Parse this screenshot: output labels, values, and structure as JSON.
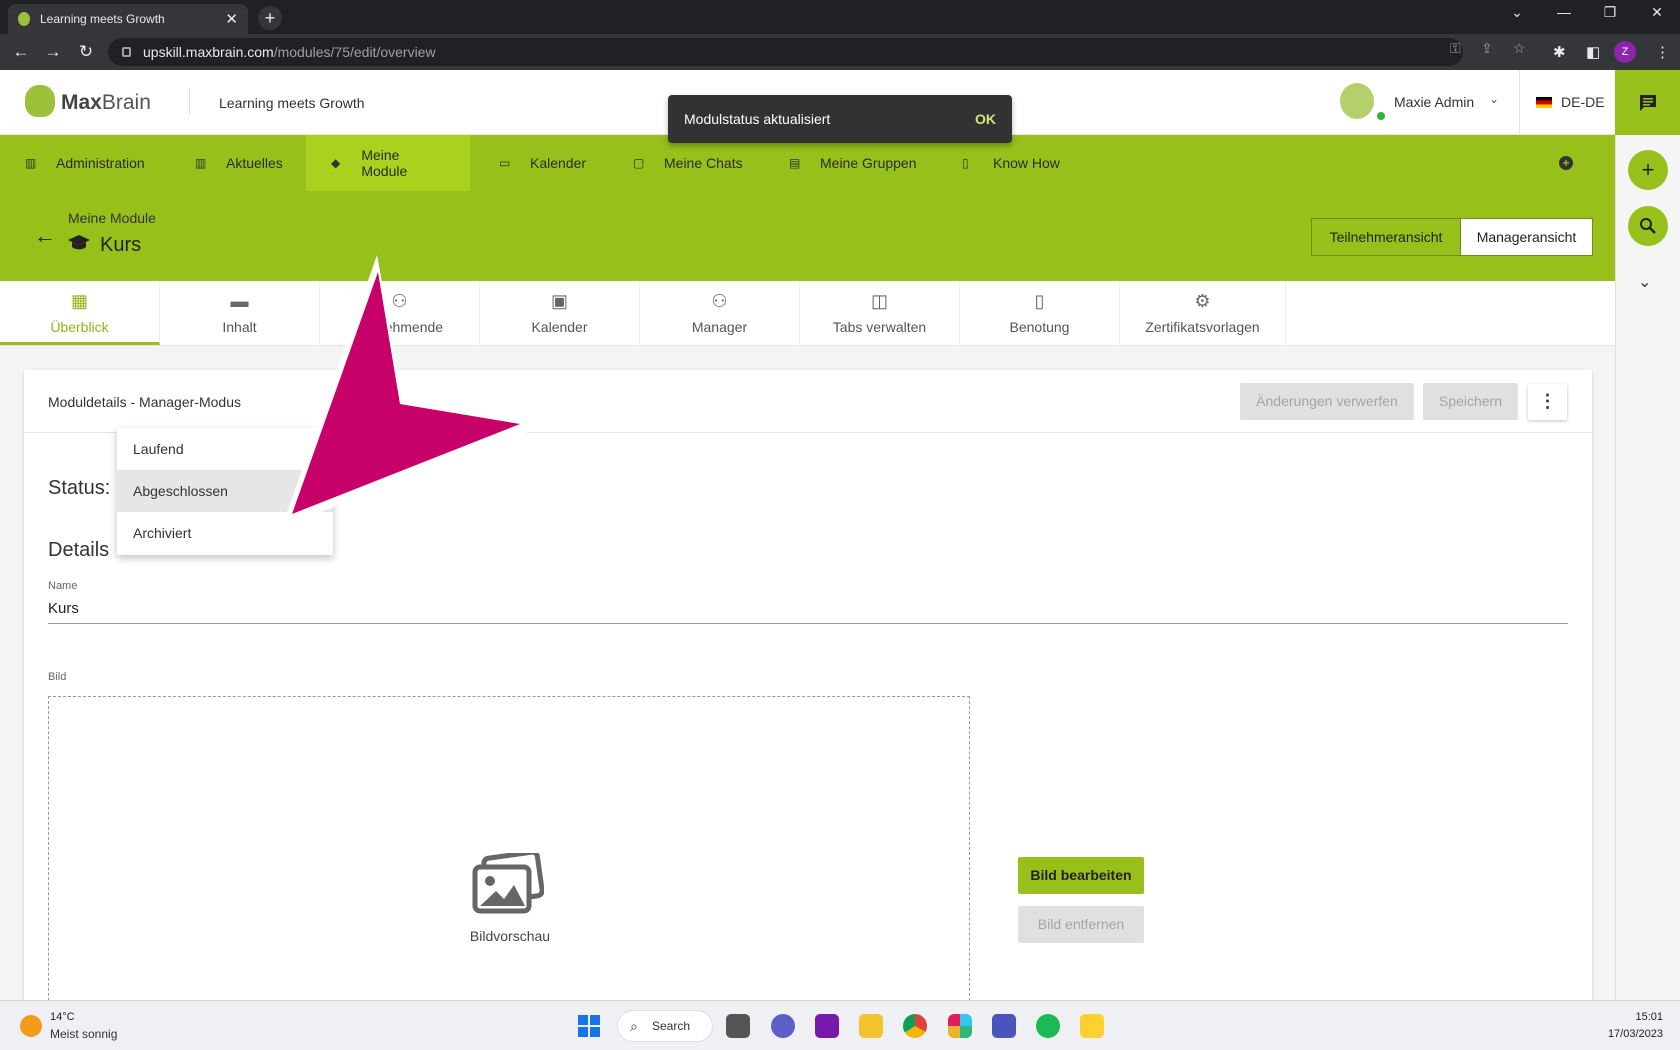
{
  "browser": {
    "tab_title": "Learning meets Growth",
    "url_host": "upskill.maxbrain.com",
    "url_path": "/modules/75/edit/overview",
    "profile_initial": "Z"
  },
  "header": {
    "brand_bold": "Max",
    "brand_light": "Brain",
    "tagline": "Learning meets Growth",
    "user_name": "Maxie Admin",
    "language": "DE-DE"
  },
  "toast": {
    "message": "Modulstatus aktualisiert",
    "action": "OK"
  },
  "main_nav": {
    "items": [
      {
        "label": "Administration",
        "icon": "building-icon"
      },
      {
        "label": "Aktuelles",
        "icon": "news-icon"
      },
      {
        "label": "Meine Module",
        "icon": "graduation-cap-icon"
      },
      {
        "label": "Kalender",
        "icon": "calendar-icon"
      },
      {
        "label": "Meine Chats",
        "icon": "chat-icon"
      },
      {
        "label": "Meine Gruppen",
        "icon": "group-icon"
      },
      {
        "label": "Know How",
        "icon": "book-icon"
      }
    ],
    "active": "Meine Module"
  },
  "page": {
    "breadcrumb": "Meine Module",
    "title": "Kurs",
    "view_participant": "Teilnehmeransicht",
    "view_manager": "Manageransicht"
  },
  "tabs": [
    {
      "label": "Überblick",
      "icon": "dashboard-icon"
    },
    {
      "label": "Inhalt",
      "icon": "folder-icon"
    },
    {
      "label": "Teilnehmende",
      "icon": "people-icon"
    },
    {
      "label": "Kalender",
      "icon": "calendar-icon"
    },
    {
      "label": "Manager",
      "icon": "manager-icon"
    },
    {
      "label": "Tabs verwalten",
      "icon": "window-icon"
    },
    {
      "label": "Benotung",
      "icon": "grade-document-icon"
    },
    {
      "label": "Zertifikatsvorlagen",
      "icon": "certificate-settings-icon"
    }
  ],
  "card": {
    "title": "Moduldetails - Manager-Modus",
    "discard_label": "Änderungen verwerfen",
    "save_label": "Speichern"
  },
  "form": {
    "status_label": "Status:",
    "status_options": [
      "Laufend",
      "Abgeschlossen",
      "Archiviert"
    ],
    "highlighted_option": "Abgeschlossen",
    "details_heading": "Details",
    "name_label": "Name",
    "name_value": "Kurs",
    "image_label": "Bild",
    "image_preview_label": "Bildvorschau",
    "edit_image_label": "Bild bearbeiten",
    "remove_image_label": "Bild entfernen"
  },
  "taskbar": {
    "temperature": "14°C",
    "weather": "Meist sonnig",
    "search_label": "Search",
    "time": "15:01",
    "date": "17/03/2023"
  },
  "colors": {
    "brand_green": "#97c11a",
    "pointer_magenta": "#c8006a",
    "toast_bg": "#323232"
  }
}
